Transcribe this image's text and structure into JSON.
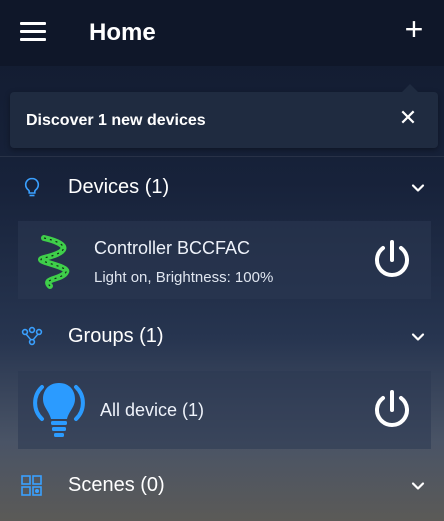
{
  "header": {
    "title": "Home"
  },
  "banner": {
    "text": "Discover 1 new devices"
  },
  "sections": {
    "devices": {
      "label": "Devices (1)"
    },
    "groups": {
      "label": "Groups (1)"
    },
    "scenes": {
      "label": "Scenes (0)"
    }
  },
  "devices": [
    {
      "name": "Controller  BCCFAC",
      "status": "Light on, Brightness: 100%"
    }
  ],
  "groups": [
    {
      "name": "All device (1)"
    }
  ],
  "colors": {
    "appbar": "#0f1729",
    "accent_blue": "#3aa0ff",
    "strip_green": "#3fcf4a"
  }
}
